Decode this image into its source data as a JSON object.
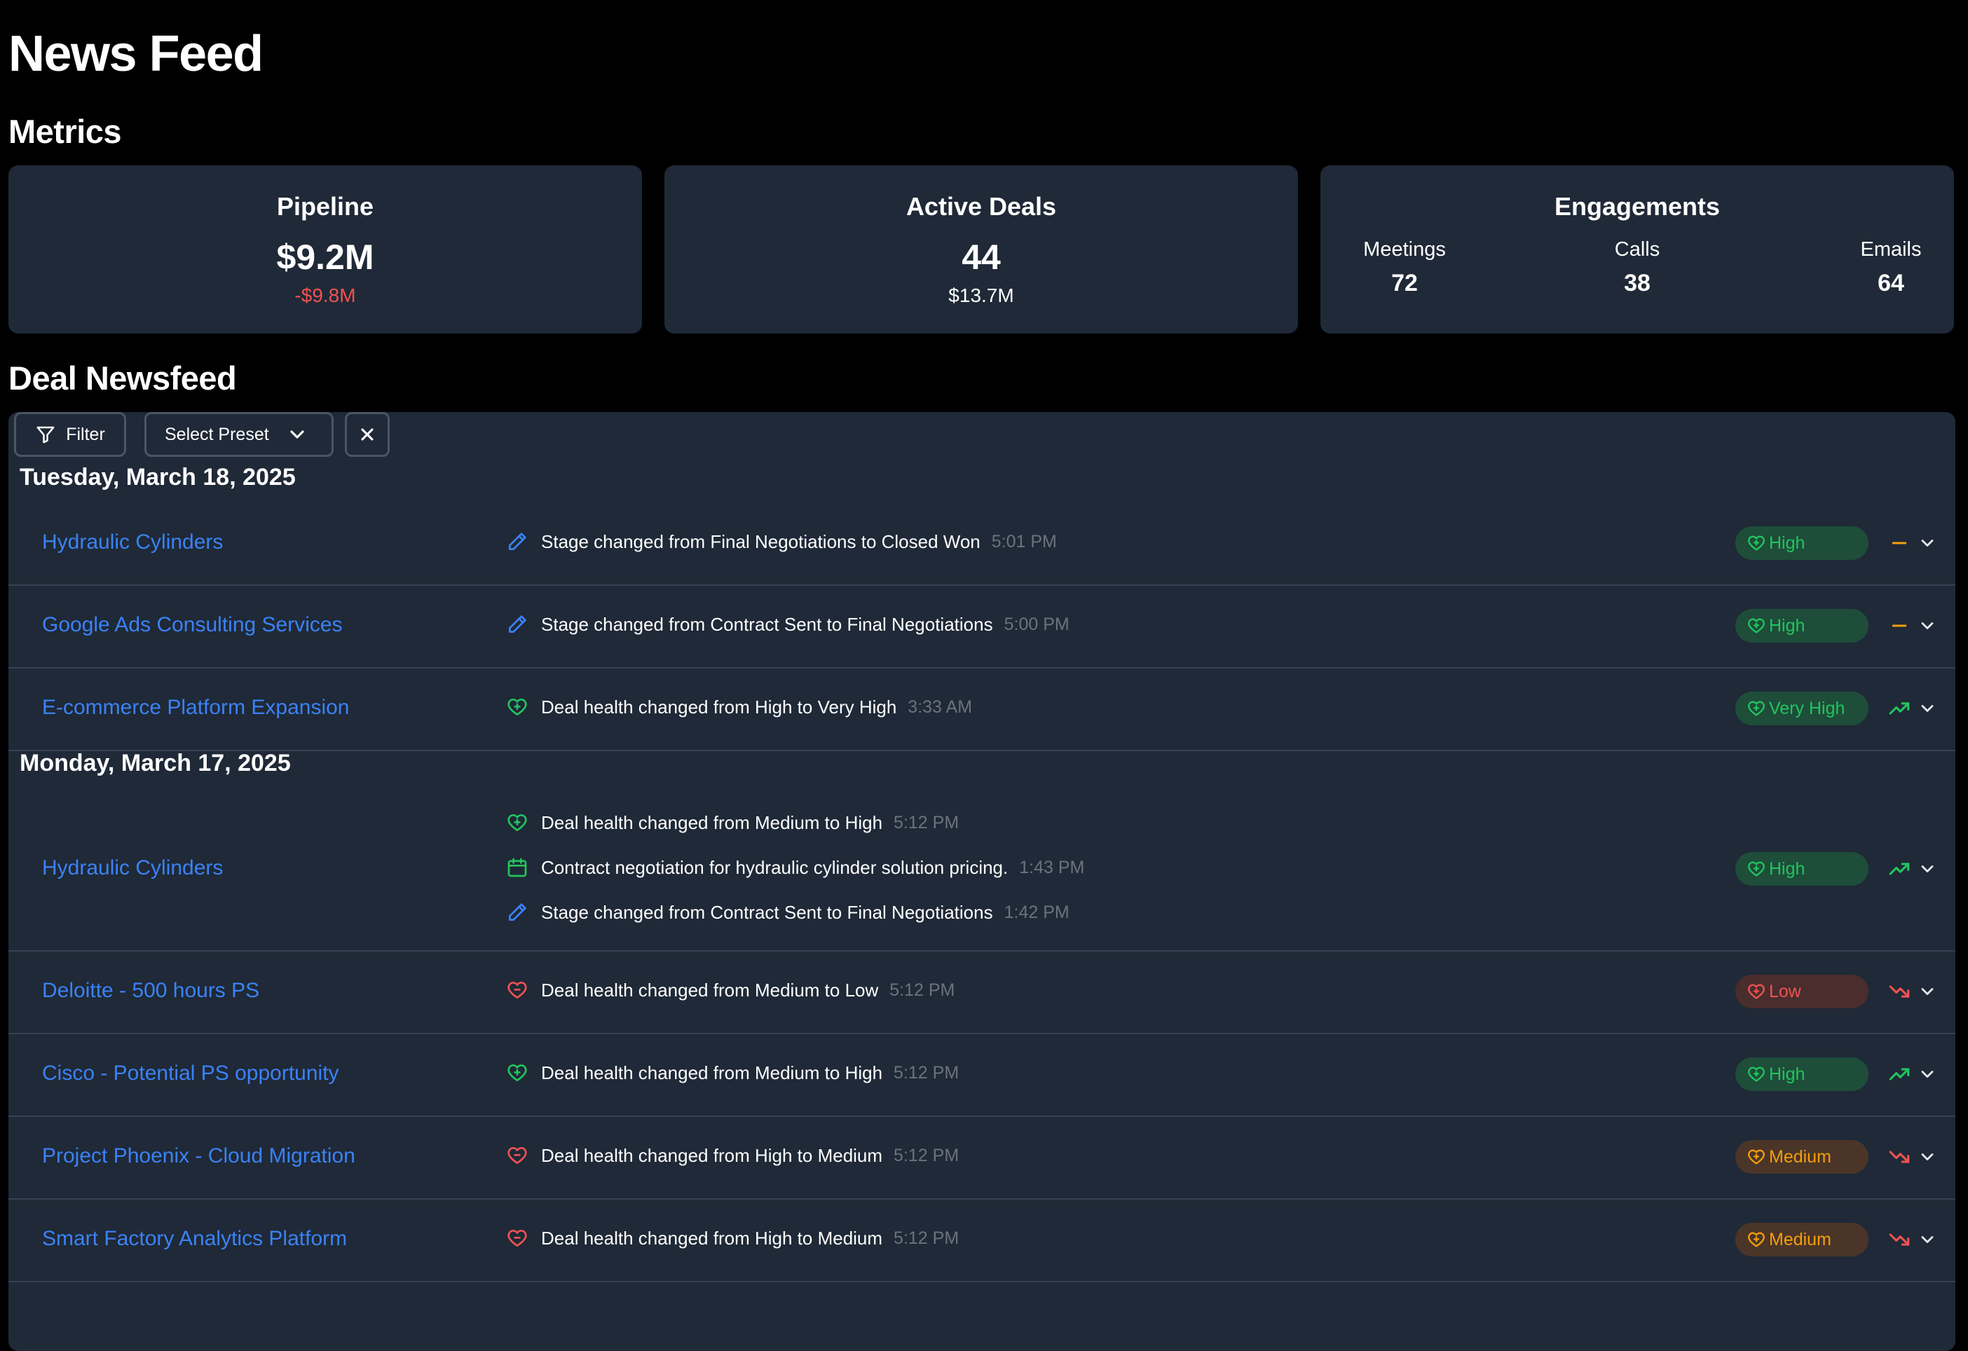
{
  "page": {
    "title": "News Feed"
  },
  "metrics": {
    "heading": "Metrics",
    "pipeline": {
      "title": "Pipeline",
      "value": "$9.2M",
      "sub": "-$9.8M"
    },
    "active_deals": {
      "title": "Active Deals",
      "value": "44",
      "sub": "$13.7M"
    },
    "engagements": {
      "title": "Engagements",
      "items": [
        {
          "label": "Meetings",
          "value": "72"
        },
        {
          "label": "Calls",
          "value": "38"
        },
        {
          "label": "Emails",
          "value": "64"
        }
      ]
    }
  },
  "newsfeed": {
    "heading": "Deal Newsfeed",
    "toolbar": {
      "filter_label": "Filter",
      "preset_label": "Select Preset"
    },
    "days": [
      {
        "date": "Tuesday, March 18, 2025",
        "rows": [
          {
            "deal": "Hydraulic Cylinders",
            "events": [
              {
                "icon": "pencil-icon",
                "text": "Stage changed from Final Negotiations to Closed Won",
                "time": "5:01 PM"
              }
            ],
            "health": "High",
            "trend": "flat"
          },
          {
            "deal": "Google Ads Consulting Services",
            "events": [
              {
                "icon": "pencil-icon",
                "text": "Stage changed from Contract Sent to Final Negotiations",
                "time": "5:00 PM"
              }
            ],
            "health": "High",
            "trend": "flat"
          },
          {
            "deal": "E-commerce Platform Expansion",
            "events": [
              {
                "icon": "heart-plus-icon",
                "text": "Deal health changed from High to Very High",
                "time": "3:33 AM"
              }
            ],
            "health": "Very High",
            "trend": "up"
          }
        ]
      },
      {
        "date": "Monday, March 17, 2025",
        "rows": [
          {
            "deal": "Hydraulic Cylinders",
            "events": [
              {
                "icon": "heart-plus-icon",
                "text": "Deal health changed from Medium to High",
                "time": "5:12 PM"
              },
              {
                "icon": "calendar-icon",
                "text": "Contract negotiation for hydraulic cylinder solution pricing.",
                "time": "1:43 PM"
              },
              {
                "icon": "pencil-icon",
                "text": "Stage changed from Contract Sent to Final Negotiations",
                "time": "1:42 PM"
              }
            ],
            "health": "High",
            "trend": "up"
          },
          {
            "deal": "Deloitte - 500 hours PS",
            "events": [
              {
                "icon": "heart-minus-icon",
                "text": "Deal health changed from Medium to Low",
                "time": "5:12 PM"
              }
            ],
            "health": "Low",
            "trend": "down"
          },
          {
            "deal": "Cisco - Potential PS opportunity",
            "events": [
              {
                "icon": "heart-plus-icon",
                "text": "Deal health changed from Medium to High",
                "time": "5:12 PM"
              }
            ],
            "health": "High",
            "trend": "up"
          },
          {
            "deal": "Project Phoenix - Cloud Migration",
            "events": [
              {
                "icon": "heart-minus-icon",
                "text": "Deal health changed from High to Medium",
                "time": "5:12 PM"
              }
            ],
            "health": "Medium",
            "trend": "down"
          },
          {
            "deal": "Smart Factory Analytics Platform",
            "events": [
              {
                "icon": "heart-minus-icon",
                "text": "Deal health changed from High to Medium",
                "time": "5:12 PM"
              }
            ],
            "health": "Medium",
            "trend": "down"
          }
        ]
      }
    ]
  },
  "colors": {
    "background": "#000000",
    "card": "#1f2937",
    "link": "#3b82f6",
    "positive": "#22c55e",
    "negative": "#f05252",
    "warning": "#f59e0b"
  }
}
